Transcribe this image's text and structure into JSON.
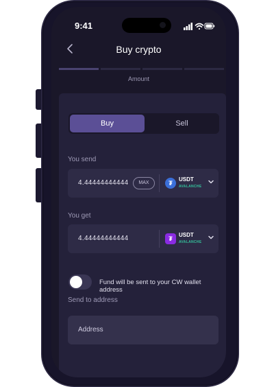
{
  "status_bar": {
    "time": "9:41"
  },
  "header": {
    "title": "Buy crypto",
    "back_icon": "chevron-left-icon"
  },
  "progress": {
    "total_steps": 4,
    "current_step": 1
  },
  "step_label": "Amount",
  "tabs": [
    {
      "label": "Buy",
      "active": true
    },
    {
      "label": "Sell",
      "active": false
    }
  ],
  "send": {
    "label": "You send",
    "value": "4.44444444444",
    "max_label": "MAX",
    "currency": {
      "ticker": "USDT",
      "network": "AVALANCHE",
      "color": "#3b6fd8",
      "symbol": "₮"
    }
  },
  "get": {
    "label": "You get",
    "value": "4.44444444444",
    "currency": {
      "ticker": "USDT",
      "network": "AVALANCHE",
      "color": "#8a2be2",
      "symbol": "₮"
    }
  },
  "wallet_toggle": {
    "label": "Fund will be sent to your CW wallet address",
    "on": false
  },
  "address": {
    "label": "Send to address",
    "placeholder": "Address"
  },
  "colors": {
    "accent": "#5b4f96",
    "network": "#34c39c",
    "background": "#1a1729",
    "card": "#24213a"
  }
}
